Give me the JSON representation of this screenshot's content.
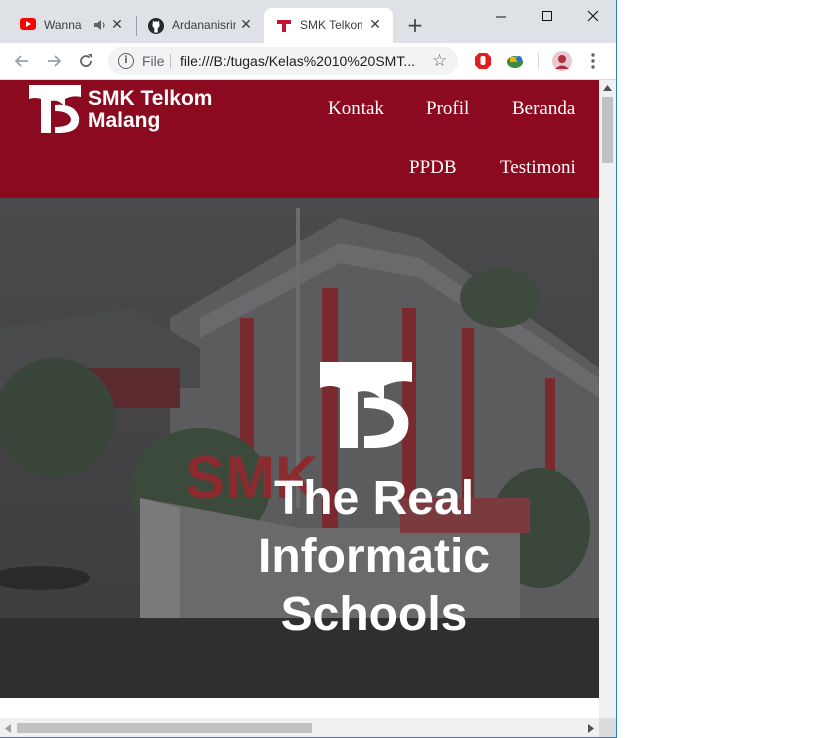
{
  "browser": {
    "tabs": [
      {
        "title": "Wanna",
        "icon": "youtube-icon",
        "audio": true
      },
      {
        "title": "Ardananisrin",
        "icon": "github-icon"
      },
      {
        "title": "SMK Telkom",
        "icon": "telkom-favicon",
        "active": true
      }
    ],
    "omnibox": {
      "security_label": "File",
      "url": "file:///B:/tugas/Kelas%2010%20SMT..."
    }
  },
  "page": {
    "brand": {
      "line1": "SMK Telkom",
      "line2": "Malang"
    },
    "nav": [
      "Kontak",
      "Profil",
      "Beranda",
      "PPDB",
      "Testimoni"
    ],
    "hero": {
      "title_lines": [
        "The Real",
        "Informatic",
        "Schools"
      ]
    },
    "colors": {
      "brand": "#8c0a20",
      "hero_overlay": "#3a3a3c"
    }
  }
}
